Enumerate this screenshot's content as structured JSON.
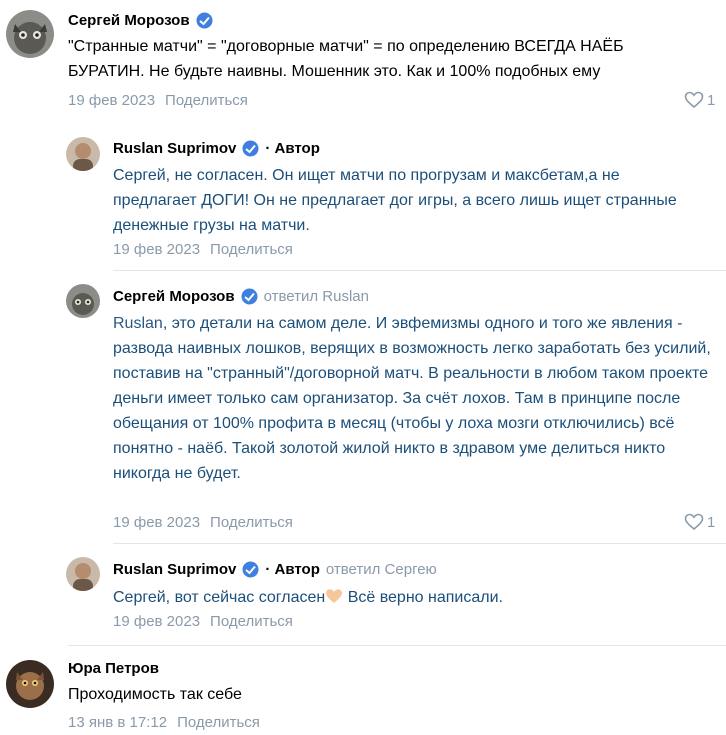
{
  "comments": [
    {
      "author": "Сергей Морозов",
      "text": "\"Странные матчи\" = \"договорные матчи\" = по определению ВСЕГДА НАЁБ БУРАТИН. Не будьте наивны. Мошенник это. Как и 100% подобных ему",
      "date": "19 фев 2023",
      "share": "Поделиться",
      "likes": "1"
    },
    {
      "author": "Ruslan Suprimov",
      "author_tag": "· Автор",
      "text": "Сергей, не согласен. Он ищет матчи по прогрузам и максбетам,а не предлагает ДОГИ! Он не предлагает дог игры, а всего лишь ищет странные денежные грузы на матчи.",
      "date": "19 фев 2023",
      "share": "Поделиться"
    },
    {
      "author": "Сергей Морозов",
      "reply_to": "ответил Ruslan",
      "mention": "Ruslan",
      "text": ", это детали на самом деле. И эвфемизмы одного и того же явления - развода наивных лошков, верящих в возможность легко заработать без усилий, поставив на \"странный\"/договорной матч. В реальности в любом таком проекте деньги имеет только сам организатор. За счёт лохов. Там в принципе после обещания от 100% профита в месяц (чтобы у лоха мозги отключились) всё понятно - наёб. Такой золотой жилой никто в здравом уме делиться никто никогда не будет.",
      "date": "19 фев 2023",
      "share": "Поделиться",
      "likes": "1"
    },
    {
      "author": "Ruslan Suprimov",
      "author_tag": "· Автор",
      "reply_to": "ответил Сергею",
      "text_a": "Сергей, вот сейчас согласен",
      "text_b": " Всё верно написали.",
      "date": "19 фев 2023",
      "share": "Поделиться"
    },
    {
      "author": "Юра Петров",
      "text": "Проходимость так себе",
      "date": "13 янв в 17:12",
      "share": "Поделиться"
    }
  ],
  "icons": {
    "badge": "verified-badge-icon",
    "like": "heart-icon",
    "emoji": "heart-hands-emoji-icon"
  },
  "colors": {
    "meta": "#8a9aaa",
    "reply_text": "#1b4f7a",
    "badge": "#3f7fe0"
  }
}
